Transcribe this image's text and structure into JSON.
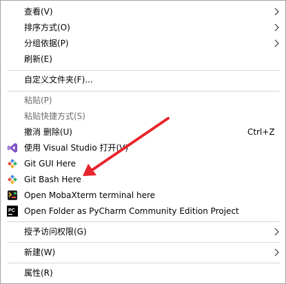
{
  "menu": {
    "items": [
      {
        "label": "查看(V)"
      },
      {
        "label": "排序方式(O)"
      },
      {
        "label": "分组依据(P)"
      },
      {
        "label": "刷新(E)"
      },
      {
        "label": "自定义文件夹(F)..."
      },
      {
        "label": "粘贴(P)"
      },
      {
        "label": "粘贴快捷方式(S)"
      },
      {
        "label": "撤消 删除(U)",
        "shortcut": "Ctrl+Z"
      },
      {
        "label": "使用 Visual Studio 打开(V)"
      },
      {
        "label": "Git GUI Here"
      },
      {
        "label": "Git Bash Here"
      },
      {
        "label": "Open MobaXterm terminal here"
      },
      {
        "label": "Open Folder as PyCharm Community Edition Project"
      },
      {
        "label": "授予访问权限(G)"
      },
      {
        "label": "新建(W)"
      },
      {
        "label": "属性(R)"
      }
    ]
  },
  "icons": {
    "visual_studio": "visual-studio-icon",
    "git_gui": "git-gui-icon",
    "git_bash": "git-bash-icon",
    "mobaxterm": "mobaxterm-icon",
    "pycharm": "pycharm-icon",
    "pycharm_text": "PC",
    "submenu": "chevron-right-icon"
  },
  "colors": {
    "annotation_arrow": "#e8242c",
    "disabled_text": "#6d6d6d",
    "separator": "#d7d7d7"
  }
}
